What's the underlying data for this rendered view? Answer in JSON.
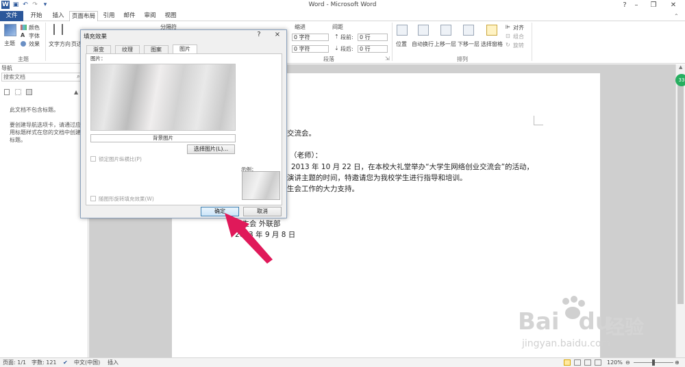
{
  "app": {
    "title": "Word - Microsoft Word",
    "quick_access": [
      "W",
      "save",
      "undo",
      "redo",
      "more"
    ]
  },
  "tabs": [
    {
      "label": "文件",
      "kind": "file"
    },
    {
      "label": "开始"
    },
    {
      "label": "插入"
    },
    {
      "label": "页面布局",
      "active": true
    },
    {
      "label": "引用"
    },
    {
      "label": "邮件"
    },
    {
      "label": "审阅"
    },
    {
      "label": "视图"
    }
  ],
  "ribbon": {
    "theme_group": {
      "label": "主题",
      "big_button": "主题",
      "items": [
        "颜色",
        "字体",
        "效果"
      ]
    },
    "page_setup": {
      "text_direction": "文字方向",
      "margins": "页边",
      "separator": "分隔符"
    },
    "indent": {
      "header": "缩进",
      "left_label": "",
      "left_value": "0 字符",
      "right_value": "0 字符"
    },
    "spacing": {
      "header": "间距",
      "before_label": "段前:",
      "before_value": "0 行",
      "after_label": "段后:",
      "after_value": "0 行"
    },
    "paragraph_group_label": "段落",
    "arrange": {
      "label": "排列",
      "items": [
        "位置",
        "自动换行",
        "上移一层",
        "下移一层",
        "选择窗格"
      ],
      "side_items": [
        "对齐",
        "组合",
        "旋转"
      ]
    }
  },
  "navpane": {
    "title": "导航",
    "search_placeholder": "搜索文档",
    "line1": "此文档不包含标题。",
    "line2": "要创建导航选项卡，请通过应",
    "line3": "用标题样式在您的文档中创建",
    "line4": "标题。"
  },
  "document": {
    "lines": [
      "交流会。",
      "（老师）：",
      "2013 年 10 月 22 日，在本校大礼堂举办“大学生网络创业交流会”的活动，",
      "演讲主题的时间，特邀请您为我校学生进行指导和培训。",
      "生会工作的大力支持。",
      "学生会 外联部",
      "2013 年 9 月 8 日"
    ]
  },
  "dialog": {
    "title": "填充效果",
    "help": "?",
    "close": "×",
    "tabs": [
      "渐变",
      "纹理",
      "图案",
      "图片"
    ],
    "active_tab": "图片",
    "picture_label": "图片：",
    "caption": "背景图片",
    "select_button": "选择图片(L)...",
    "lock_aspect": "锁定图片纵横比(P)",
    "rotate_with_shape": "随图形旋转填充效果(W)",
    "sample_label": "示例：",
    "ok": "确定",
    "cancel": "取消"
  },
  "statusbar": {
    "page": "页面: 1/1",
    "words": "字数: 121",
    "language": "中文(中国)",
    "mode": "插入",
    "zoom": "120%"
  },
  "badge": "33",
  "watermark": {
    "brand": "Bai",
    "brand2": "du",
    "cn": "经验",
    "url": "jingyan.baidu.com"
  },
  "colors": {
    "file_tab": "#2b579a",
    "arrow": "#e0195a",
    "badge": "#27ae60"
  }
}
